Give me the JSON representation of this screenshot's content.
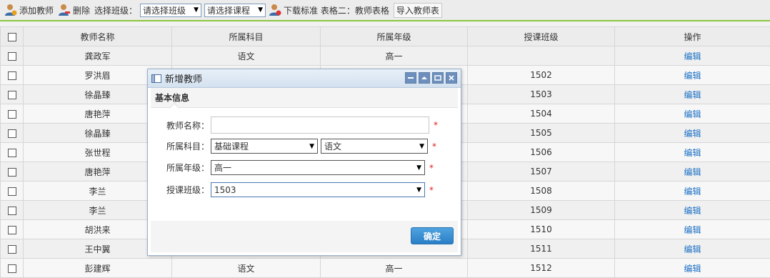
{
  "toolbar": {
    "add_teacher": "添加教师",
    "delete": "删除",
    "select_class_label": "选择班级：",
    "class_select": "请选择班级",
    "course_select": "请选择课程",
    "download_template": "下载标准 表格二：教师表格",
    "import_teachers": "导入教师表"
  },
  "table": {
    "headers": [
      "教师名称",
      "所属科目",
      "所属年级",
      "授课班级",
      "操作"
    ],
    "rows": [
      {
        "name": "龚政军",
        "subject": "语文",
        "grade": "高一",
        "class": "",
        "action": "编辑"
      },
      {
        "name": "罗洪眉",
        "subject": "",
        "grade": "",
        "class": "1502",
        "action": "编辑"
      },
      {
        "name": "徐晶臻",
        "subject": "",
        "grade": "",
        "class": "1503",
        "action": "编辑"
      },
      {
        "name": "唐艳萍",
        "subject": "",
        "grade": "",
        "class": "1504",
        "action": "编辑"
      },
      {
        "name": "徐晶臻",
        "subject": "",
        "grade": "",
        "class": "1505",
        "action": "编辑"
      },
      {
        "name": "张世程",
        "subject": "",
        "grade": "",
        "class": "1506",
        "action": "编辑"
      },
      {
        "name": "唐艳萍",
        "subject": "",
        "grade": "",
        "class": "1507",
        "action": "编辑"
      },
      {
        "name": "李兰",
        "subject": "",
        "grade": "",
        "class": "1508",
        "action": "编辑"
      },
      {
        "name": "李兰",
        "subject": "",
        "grade": "",
        "class": "1509",
        "action": "编辑"
      },
      {
        "name": "胡洪来",
        "subject": "",
        "grade": "",
        "class": "1510",
        "action": "编辑"
      },
      {
        "name": "王中翼",
        "subject": "",
        "grade": "",
        "class": "1511",
        "action": "编辑"
      },
      {
        "name": "彭建辉",
        "subject": "语文",
        "grade": "高一",
        "class": "1512",
        "action": "编辑"
      }
    ]
  },
  "dialog": {
    "title": "新增教师",
    "section": "基本信息",
    "name_label": "教师名称：",
    "name_value": "",
    "subject_label": "所属科目：",
    "subject_category": "基础课程",
    "subject_value": "语文",
    "grade_label": "所属年级：",
    "grade_value": "高一",
    "class_label": "授课班级：",
    "class_value": "1503",
    "required_mark": "*",
    "ok": "确定"
  },
  "colors": {
    "accent_line": "#8dc63f",
    "link": "#1a6fc4",
    "ok_button": "#2a7ec6",
    "required": "#e02020"
  }
}
